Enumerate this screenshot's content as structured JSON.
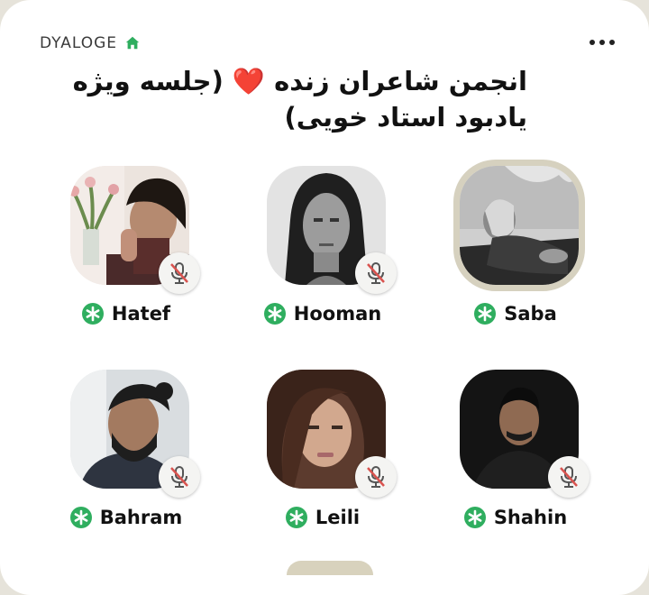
{
  "club": {
    "name": "DYALOGE",
    "icon": "home-icon"
  },
  "header": {
    "more_icon": "more-horizontal-icon"
  },
  "room": {
    "title": "انجمن شاعران زنده ❤️ (جلسه ویژه یادبود استاد خویی)"
  },
  "colors": {
    "accent": "#2fae5f",
    "mute_red": "#d9534f",
    "ring": "#d6d1bf"
  },
  "speakers": [
    {
      "name": "Hatef",
      "muted": true,
      "moderator": true
    },
    {
      "name": "Hooman",
      "muted": true,
      "moderator": true
    },
    {
      "name": "Saba",
      "muted": false,
      "moderator": true,
      "speaking_ring": true
    },
    {
      "name": "Bahram",
      "muted": true,
      "moderator": true
    },
    {
      "name": "Leili",
      "muted": true,
      "moderator": true
    },
    {
      "name": "Shahin",
      "muted": true,
      "moderator": true
    }
  ]
}
